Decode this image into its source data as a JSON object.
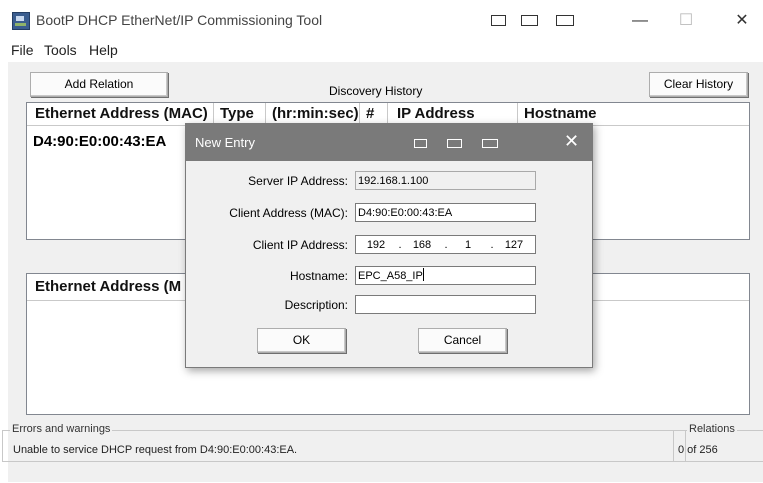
{
  "window": {
    "title": "BootP DHCP EtherNet/IP Commissioning Tool",
    "controls": {
      "minimize": "—",
      "maximize": "☐",
      "close": "✕"
    }
  },
  "menu": [
    "File",
    "Tools",
    "Help"
  ],
  "toolbar": {
    "add_relation": "Add Relation",
    "discovery_history": "Discovery History",
    "clear_history": "Clear History"
  },
  "discovery_table": {
    "columns": [
      "Ethernet Address (MAC)",
      "Type",
      "(hr:min:sec)",
      "#",
      "IP Address",
      "Hostname"
    ],
    "rows": [
      {
        "mac": "D4:90:E0:00:43:EA"
      }
    ]
  },
  "relation_table": {
    "columns": [
      "Ethernet Address (M"
    ]
  },
  "status": {
    "errors_label": "Errors and warnings",
    "message": "Unable to service DHCP request from D4:90:E0:00:43:EA.",
    "relations_label": "Relations",
    "relations_count": "0 of 256"
  },
  "dialog": {
    "title": "New Entry",
    "fields": {
      "server_ip": {
        "label": "Server IP Address:",
        "value": "192.168.1.100"
      },
      "client_mac": {
        "label": "Client Address (MAC):",
        "value": "D4:90:E0:00:43:EA"
      },
      "client_ip": {
        "label": "Client IP Address:",
        "octets": [
          "192",
          "168",
          "1",
          "127"
        ],
        "dot": "."
      },
      "hostname": {
        "label": "Hostname:",
        "value": "EPC_A58_IP"
      },
      "description": {
        "label": "Description:",
        "value": ""
      }
    },
    "ok": "OK",
    "cancel": "Cancel",
    "close": "✕"
  }
}
